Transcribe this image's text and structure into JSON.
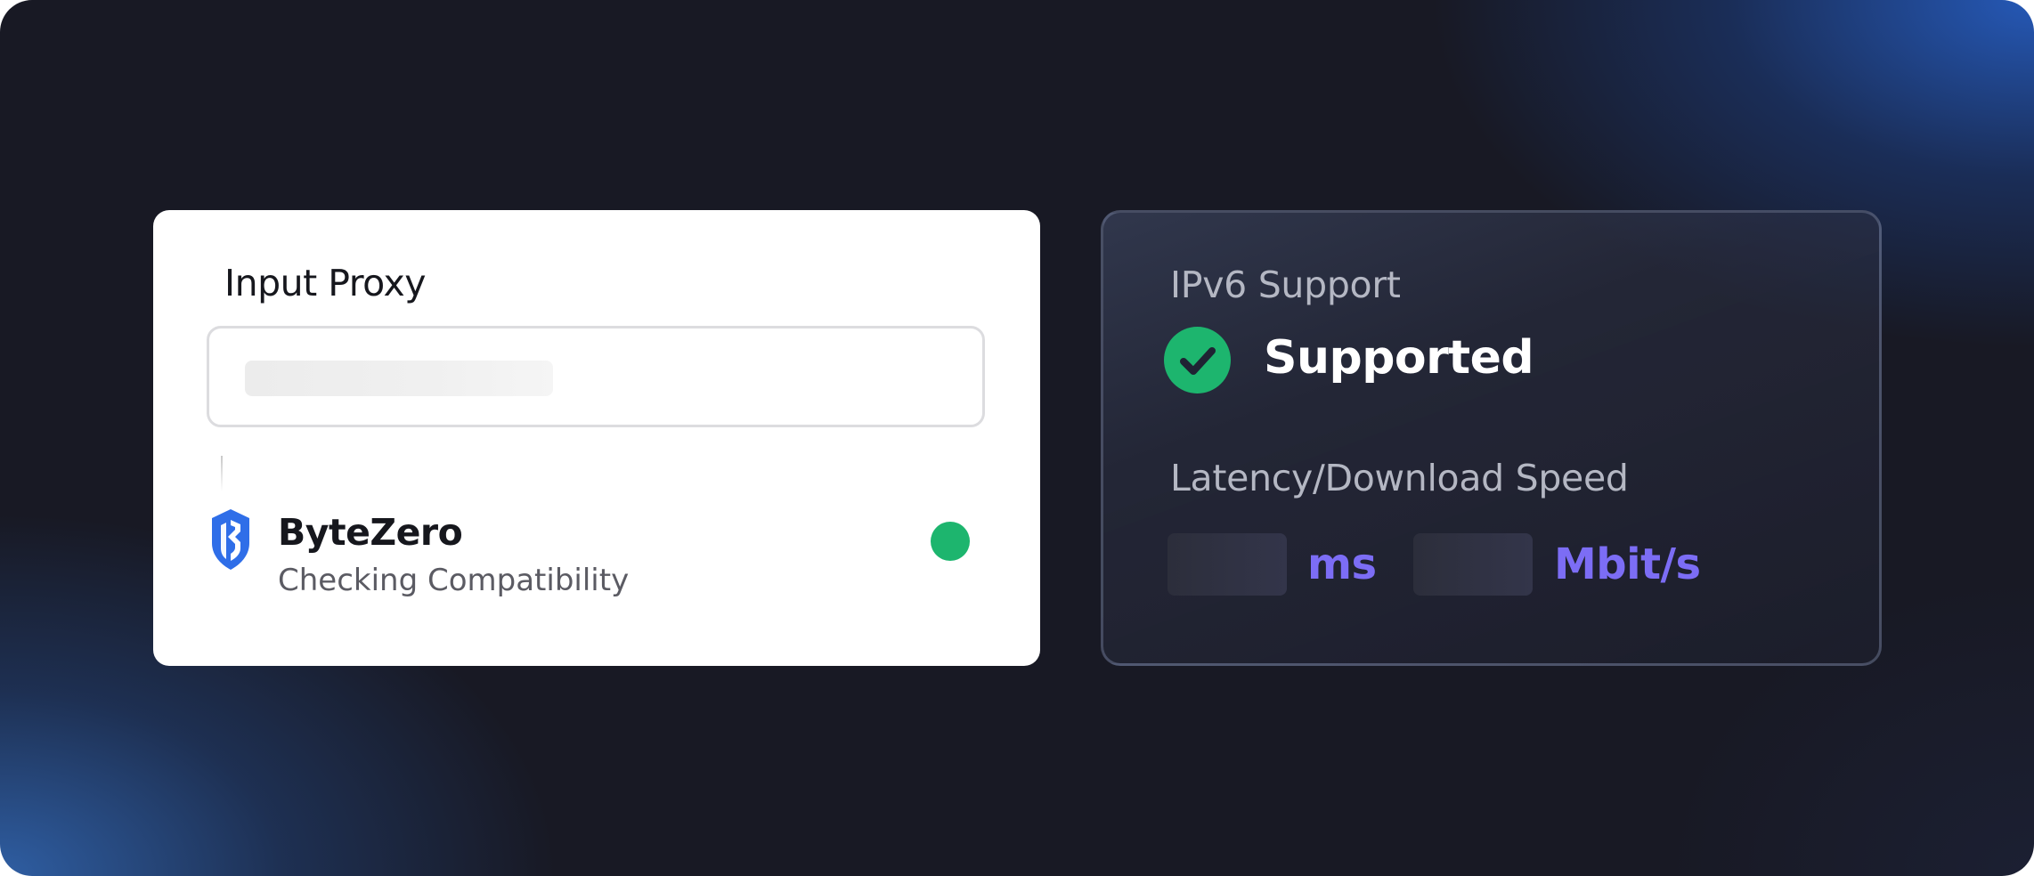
{
  "proxy_panel": {
    "title": "Input Proxy",
    "input_placeholder": "",
    "brand": {
      "name": "ByteZero",
      "status": "Checking Compatibility",
      "logo_icon": "bytezero-shield-logo",
      "indicator_color": "#1db56e"
    }
  },
  "stats_panel": {
    "ipv6_label": "IPv6 Support",
    "ipv6_status": "Supported",
    "ipv6_icon": "check-circle-icon",
    "latency_label": "Latency/Download Speed",
    "latency_unit": "ms",
    "speed_unit": "Mbit/s"
  },
  "colors": {
    "accent": "#7c6df5",
    "success": "#1db56e",
    "brand_blue": "#2f6ee8",
    "background": "#181924"
  }
}
